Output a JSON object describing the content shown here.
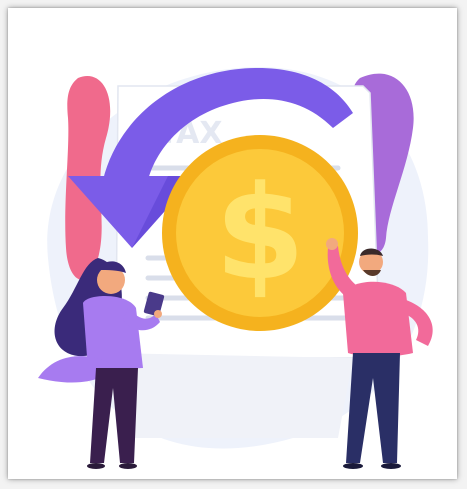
{
  "illustration": {
    "document_heading": "TAX",
    "coin_symbol": "$",
    "colors": {
      "background_blob": "#eef2fb",
      "document": "#ffffff",
      "document_lines": "#d9deea",
      "arrow": "#7b5ce8",
      "arrow_dark": "#5a3fd0",
      "coin_outer": "#f5b21e",
      "coin_inner": "#fcc93a",
      "coin_symbol": "#ffe36b",
      "pink_shape": "#f06a8c",
      "purple_shape": "#a86bd9",
      "woman_hair": "#3a2a7a",
      "woman_top": "#a77bf0",
      "woman_pants": "#3a1f4e",
      "man_top": "#f26a9a",
      "man_pants": "#2a2f66",
      "skin": "#f2a97e"
    }
  }
}
